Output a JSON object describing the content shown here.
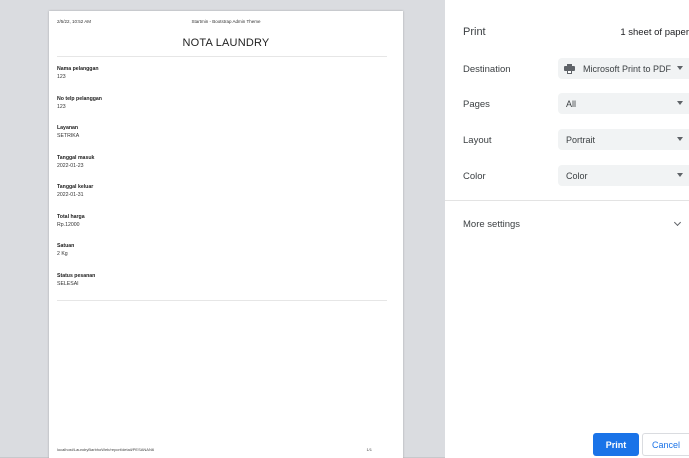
{
  "document": {
    "header_datetime": "2/5/22, 10:52 AM",
    "header_title": "Startmin - Bootstrap Admin Theme",
    "title": "NOTA LAUNDRY",
    "fields": [
      {
        "label": "Nama pelanggan",
        "value": "123"
      },
      {
        "label": "No telp pelanggan",
        "value": "123"
      },
      {
        "label": "Layanan",
        "value": "SETRIKA"
      },
      {
        "label": "Tanggal masuk",
        "value": "2022-01-23"
      },
      {
        "label": "Tanggal keluar",
        "value": "2022-01-31"
      },
      {
        "label": "Total harga",
        "value": "Rp.12000"
      },
      {
        "label": "Satuan",
        "value": "2 Kg"
      },
      {
        "label": "Status pesanan",
        "value": "SELESAI"
      }
    ],
    "footer_url": "localhost/LaundryBarbhoWeb/report/detail/PESANAN6",
    "footer_page": "1/1"
  },
  "print_panel": {
    "title": "Print",
    "sheet_count": "1 sheet of paper",
    "destination": {
      "label": "Destination",
      "value": "Microsoft Print to PDF",
      "icon": "printer-icon"
    },
    "pages": {
      "label": "Pages",
      "value": "All"
    },
    "layout": {
      "label": "Layout",
      "value": "Portrait"
    },
    "color": {
      "label": "Color",
      "value": "Color"
    },
    "more_settings": "More settings",
    "print_button": "Print",
    "cancel_button": "Cancel",
    "accent_color": "#1a73e8"
  }
}
